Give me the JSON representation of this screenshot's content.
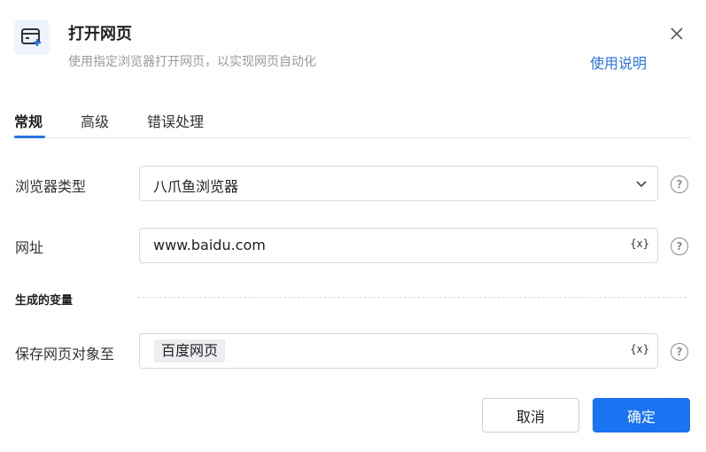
{
  "header": {
    "title": "打开网页",
    "subtitle": "使用指定浏览器打开网页，以实现网页自动化",
    "help_link": "使用说明",
    "icon": "browser-add-icon"
  },
  "tabs": [
    {
      "label": "常规",
      "active": true
    },
    {
      "label": "高级",
      "active": false
    },
    {
      "label": "错误处理",
      "active": false
    }
  ],
  "form": {
    "browser_type": {
      "label": "浏览器类型",
      "value": "八爪鱼浏览器"
    },
    "url": {
      "label": "网址",
      "value": "www.baidu.com",
      "var_button": "{x}"
    },
    "section_title": "生成的变量",
    "save_object": {
      "label": "保存网页对象至",
      "value": "百度网页",
      "var_button": "{x}"
    },
    "help_mark": "?"
  },
  "footer": {
    "cancel_label": "取消",
    "ok_label": "确定"
  },
  "colors": {
    "accent": "#1a73f0",
    "link": "#2a73e0"
  }
}
